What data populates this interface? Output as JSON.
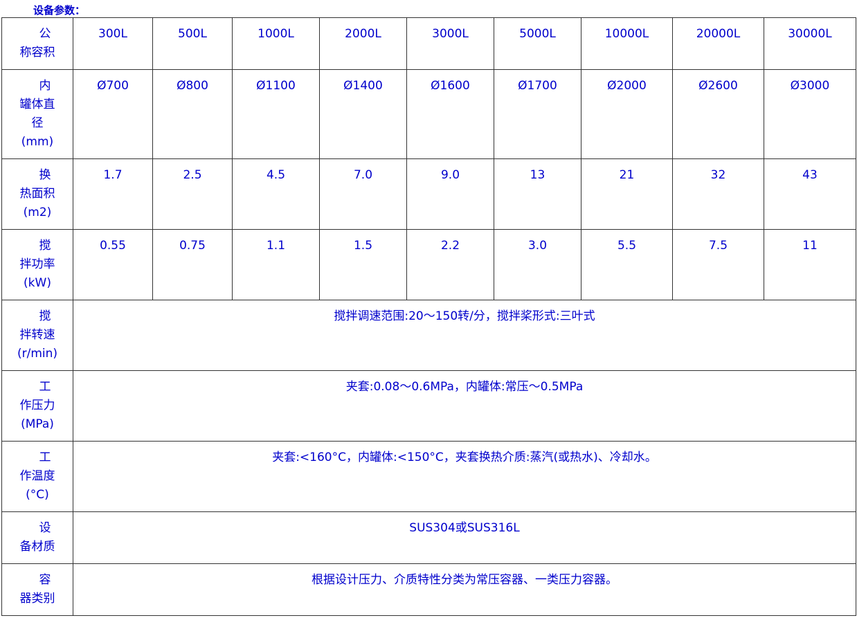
{
  "title": "设备参数：",
  "header": {
    "label_first": "公",
    "label_rest": "称容积",
    "values": [
      "300L",
      "500L",
      "1000L",
      "2000L",
      "3000L",
      "5000L",
      "10000L",
      "20000L",
      "30000L"
    ]
  },
  "rows": [
    {
      "label_first": "内",
      "label_lines": [
        "罐体直",
        "径",
        "(mm)"
      ],
      "values": [
        "Ø700",
        "Ø800",
        "Ø1100",
        "Ø1400",
        "Ø1600",
        "Ø1700",
        "Ø2000",
        "Ø2600",
        "Ø3000"
      ]
    },
    {
      "label_first": "换",
      "label_lines": [
        "热面积",
        "(m2)"
      ],
      "values": [
        "1.7",
        "2.5",
        "4.5",
        "7.0",
        "9.0",
        "13",
        "21",
        "32",
        "43"
      ]
    },
    {
      "label_first": "搅",
      "label_lines": [
        "拌功率",
        "(kW)"
      ],
      "values": [
        "0.55",
        "0.75",
        "1.1",
        "1.5",
        "2.2",
        "3.0",
        "5.5",
        "7.5",
        "11"
      ]
    }
  ],
  "span_rows": [
    {
      "label_first": "搅",
      "label_lines": [
        "拌转速",
        "(r/min)"
      ],
      "text": "搅拌调速范围:20～150转/分，搅拌桨形式:三叶式"
    },
    {
      "label_first": "工",
      "label_lines": [
        "作压力",
        "(MPa)"
      ],
      "text": "夹套:0.08～0.6MPa，内罐体:常压～0.5MPa"
    },
    {
      "label_first": "工",
      "label_lines": [
        "作温度",
        "(°C)"
      ],
      "text": "夹套:<160°C，内罐体:<150°C，夹套换热介质:蒸汽(或热水)、冷却水。"
    },
    {
      "label_first": "设",
      "label_lines": [
        "备材质"
      ],
      "text": "SUS304或SUS316L"
    },
    {
      "label_first": "容",
      "label_lines": [
        "器类别"
      ],
      "text": "根据设计压力、介质特性分类为常压容器、一类压力容器。"
    }
  ]
}
